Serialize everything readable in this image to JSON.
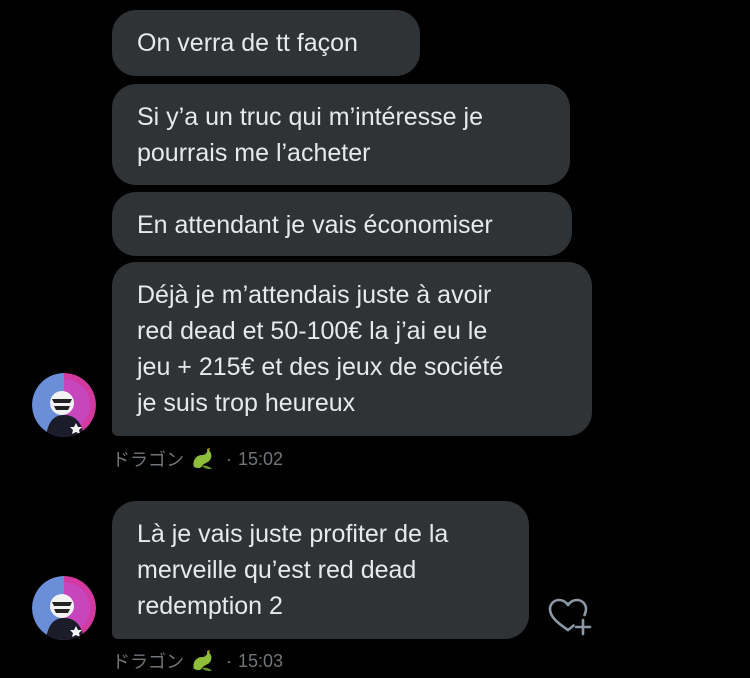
{
  "messages": [
    {
      "lines": [
        "On verra de tt façon"
      ]
    },
    {
      "lines": [
        "Si y’a un truc qui m’intéresse je",
        "pourrais me l’acheter"
      ]
    },
    {
      "lines": [
        "En attendant je vais économiser"
      ]
    },
    {
      "lines": [
        "Déjà je m’attendais juste à avoir",
        "red dead et 50-100€ la j’ai eu le",
        "jeu + 215€ et des jeux de société",
        "je suis trop heureux"
      ]
    },
    {
      "lines": [
        "Là je vais juste profiter de la",
        "merveille qu’est red dead",
        "redemption 2"
      ]
    }
  ],
  "meta": [
    {
      "sender": "ドラゴン",
      "separator": "·",
      "time": "15:02"
    },
    {
      "sender": "ドラゴン",
      "separator": "·",
      "time": "15:03"
    }
  ],
  "icons": {
    "avatar": "avatar-icon",
    "sender_emoji": "dragon-icon",
    "reaction": "add-reaction-heart-icon"
  },
  "colors": {
    "background": "#000000",
    "bubble": "#2f3336",
    "text": "#e7e9ea",
    "meta": "#71767b"
  }
}
